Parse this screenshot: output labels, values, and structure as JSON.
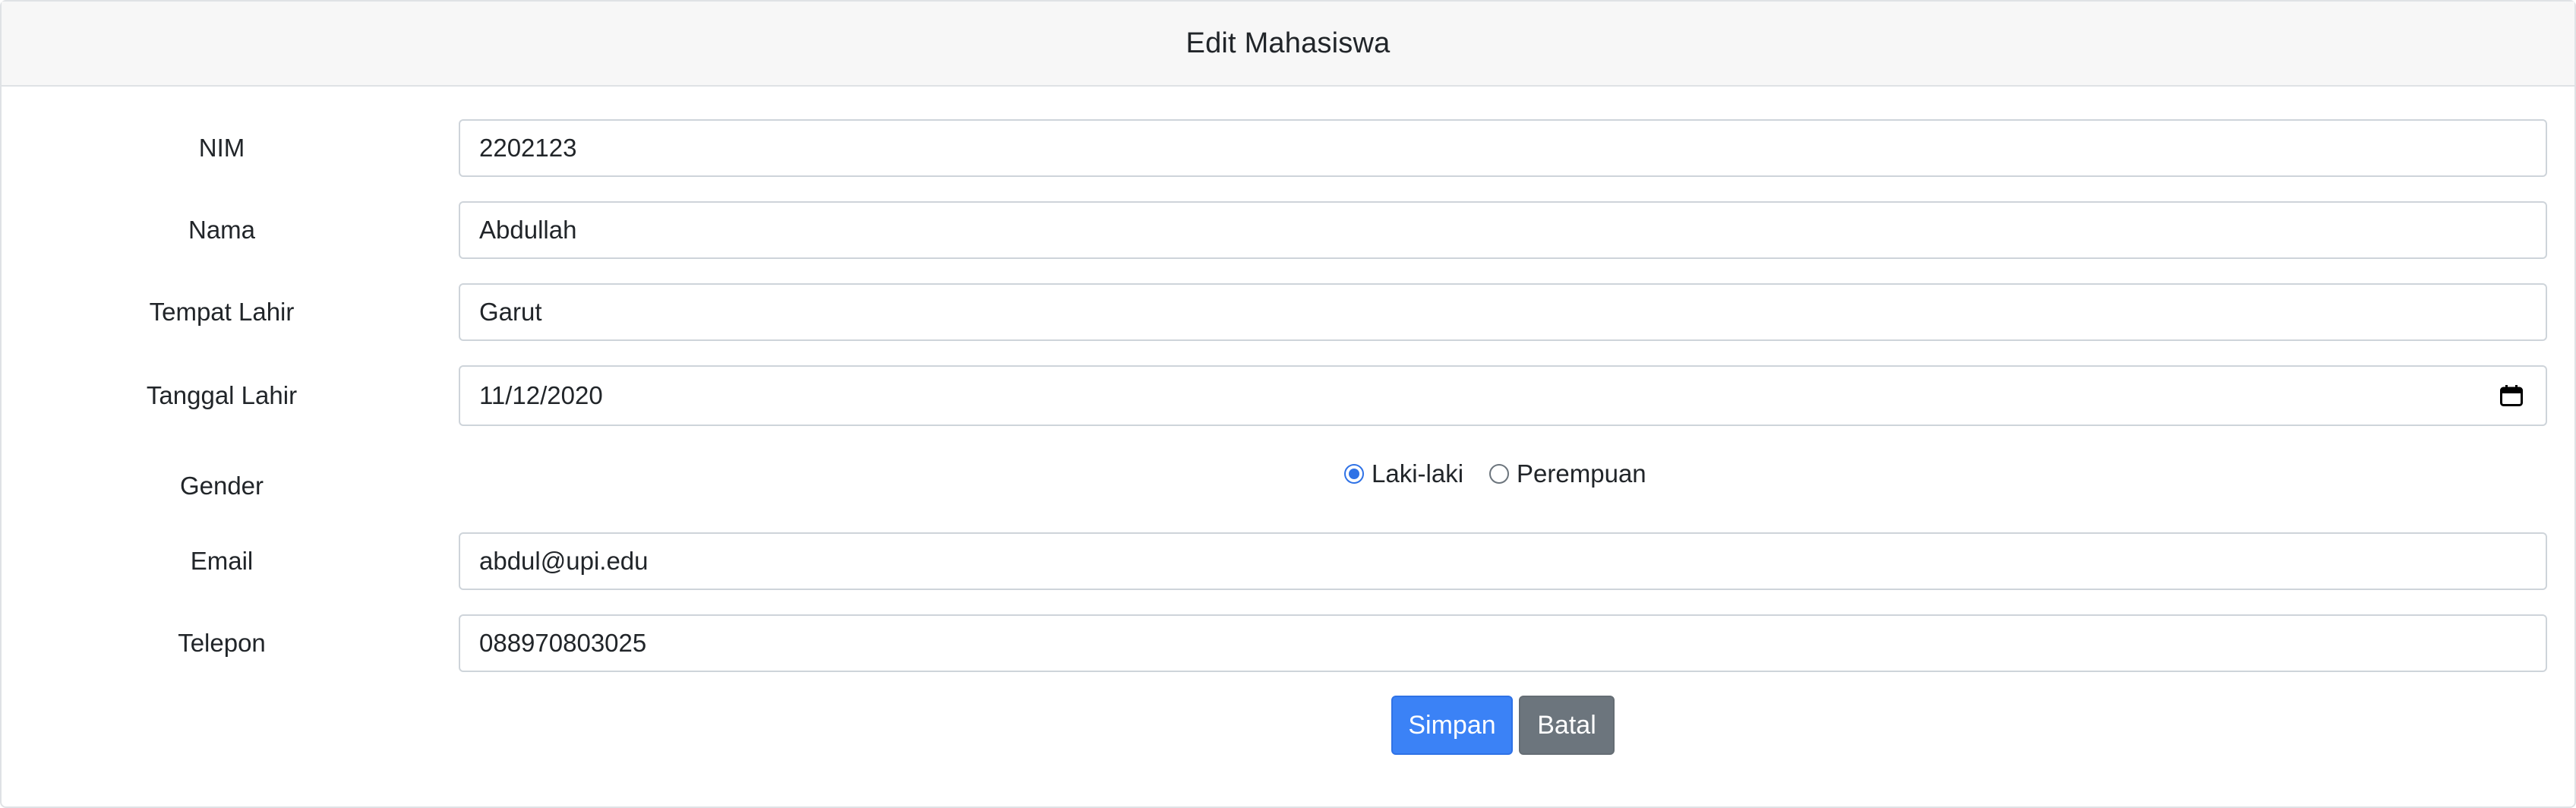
{
  "form": {
    "title": "Edit Mahasiswa",
    "fields": {
      "nim": {
        "label": "NIM",
        "value": "2202123"
      },
      "nama": {
        "label": "Nama",
        "value": "Abdullah"
      },
      "tempat_lahir": {
        "label": "Tempat Lahir",
        "value": "Garut"
      },
      "tanggal_lahir": {
        "label": "Tanggal Lahir",
        "value": "11/12/2020",
        "icon": "calendar-icon"
      },
      "gender": {
        "label": "Gender",
        "options": [
          {
            "label": "Laki-laki",
            "checked": true
          },
          {
            "label": "Perempuan",
            "checked": false
          }
        ]
      },
      "email": {
        "label": "Email",
        "value": "abdul@upi.edu"
      },
      "telepon": {
        "label": "Telepon",
        "value": "088970803025"
      }
    },
    "buttons": {
      "save_label": "Simpan",
      "cancel_label": "Batal"
    },
    "colors": {
      "primary": "#3b82f6",
      "secondary": "#6c757d",
      "radio_accent": "#2f72e6"
    }
  }
}
